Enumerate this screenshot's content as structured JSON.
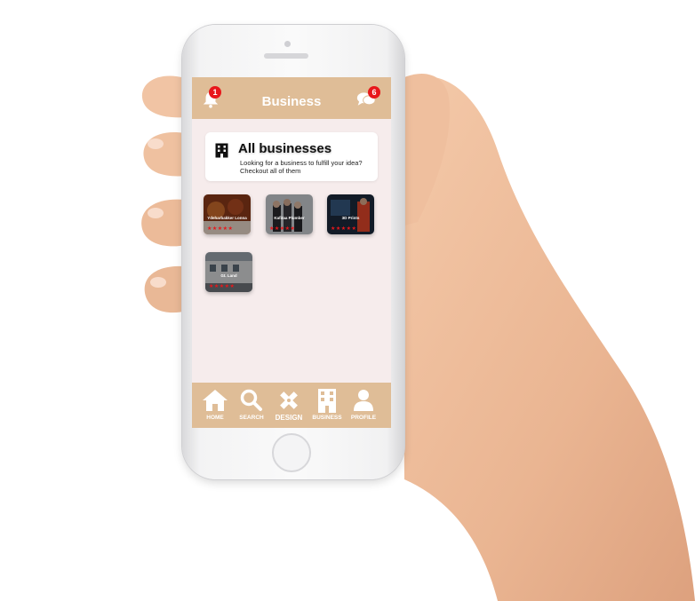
{
  "header": {
    "title": "Business",
    "notifications_count": "1",
    "messages_count": "6"
  },
  "card": {
    "title": "All businesses",
    "subtitle": "Looking for a business to fulfill your idea? Checkout all of them"
  },
  "businesses": [
    {
      "name": "Ydeharbakker Lonna",
      "rating": 5,
      "stars": "★★★★★"
    },
    {
      "name": "Kafitaa Plumber",
      "rating": 5,
      "stars": "★★★★★"
    },
    {
      "name": "3D Prints",
      "rating": 5,
      "stars": "★★★★★"
    },
    {
      "name": "Gt. Land",
      "rating": 5,
      "stars": "★★★★★"
    }
  ],
  "nav": {
    "home": "HOME",
    "search": "SEARCH",
    "design": "DESIGN",
    "business": "BUSINESS",
    "profile": "PROFILE"
  },
  "colors": {
    "accent": "#dfbd97",
    "background": "#f6ecec",
    "badge": "#e8171b",
    "star": "#e8171b"
  },
  "icons": {
    "bell": "bell-icon",
    "chat": "chat-icon",
    "building": "building-icon",
    "home": "home-icon",
    "search": "search-icon",
    "design": "pencil-ruler-icon",
    "business": "building-icon",
    "profile": "user-icon"
  }
}
